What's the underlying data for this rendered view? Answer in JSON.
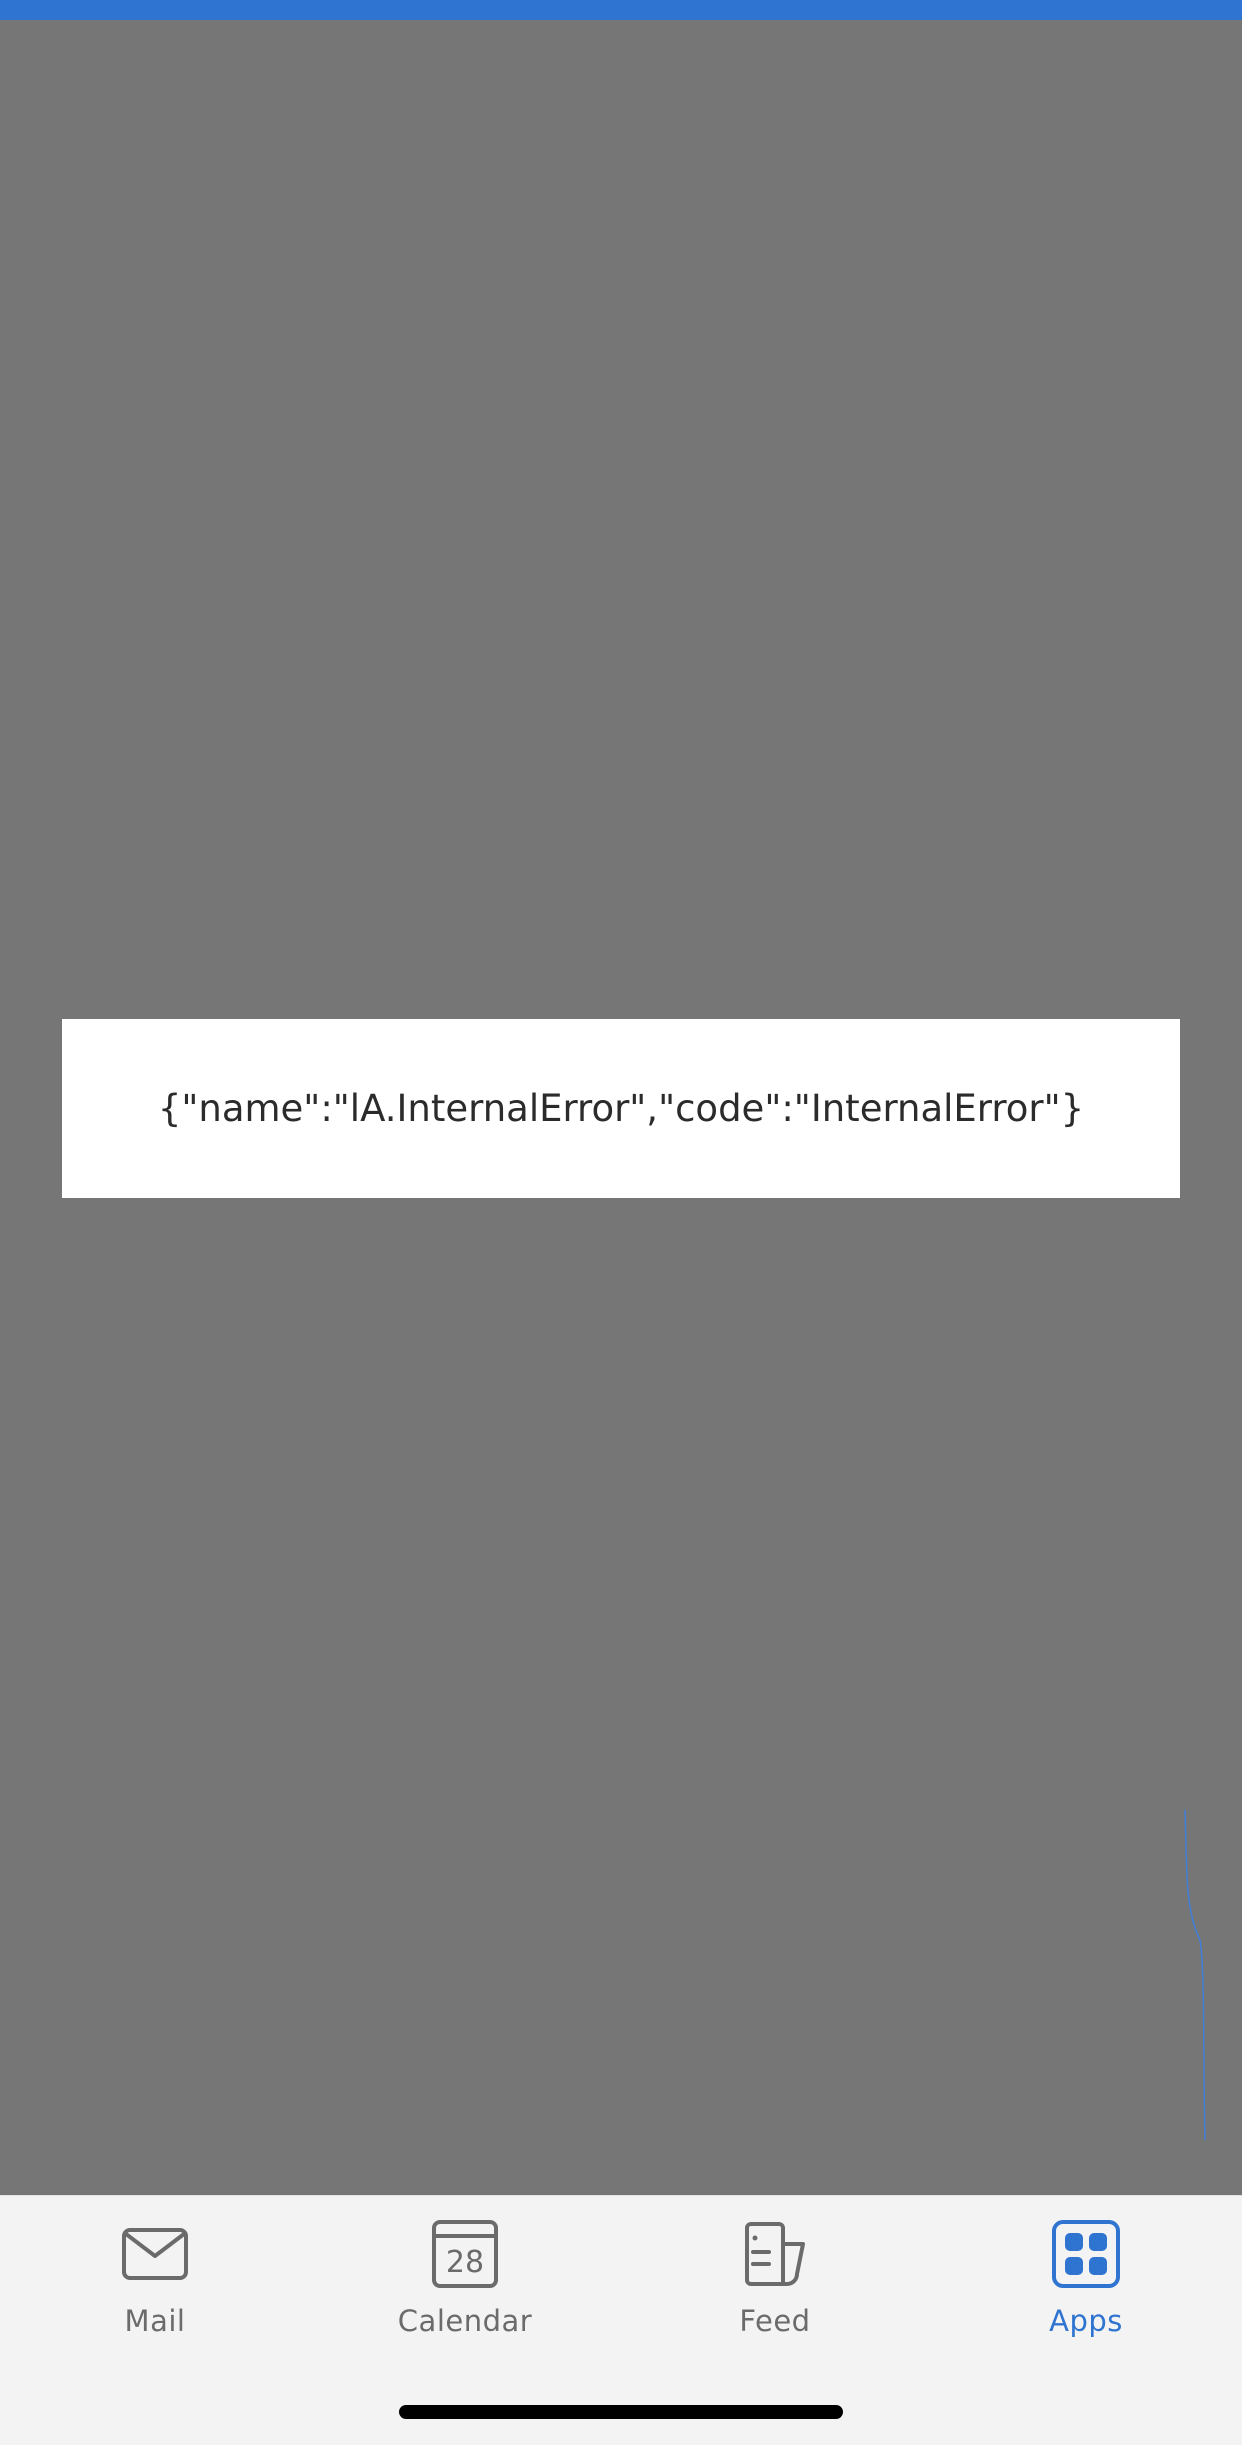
{
  "error": {
    "message": "{\"name\":\"lA.InternalError\",\"code\":\"InternalError\"}"
  },
  "colors": {
    "accent": "#2f74d0",
    "overlay": "#767676",
    "tab_bar_bg": "#f3f3f3",
    "tab_inactive": "#6b6b6b"
  },
  "tab_bar": {
    "tabs": [
      {
        "label": "Mail",
        "icon": "mail-icon",
        "active": false
      },
      {
        "label": "Calendar",
        "icon": "calendar-icon",
        "active": false,
        "icon_text": "28"
      },
      {
        "label": "Feed",
        "icon": "feed-icon",
        "active": false
      },
      {
        "label": "Apps",
        "icon": "apps-icon",
        "active": true
      }
    ]
  }
}
